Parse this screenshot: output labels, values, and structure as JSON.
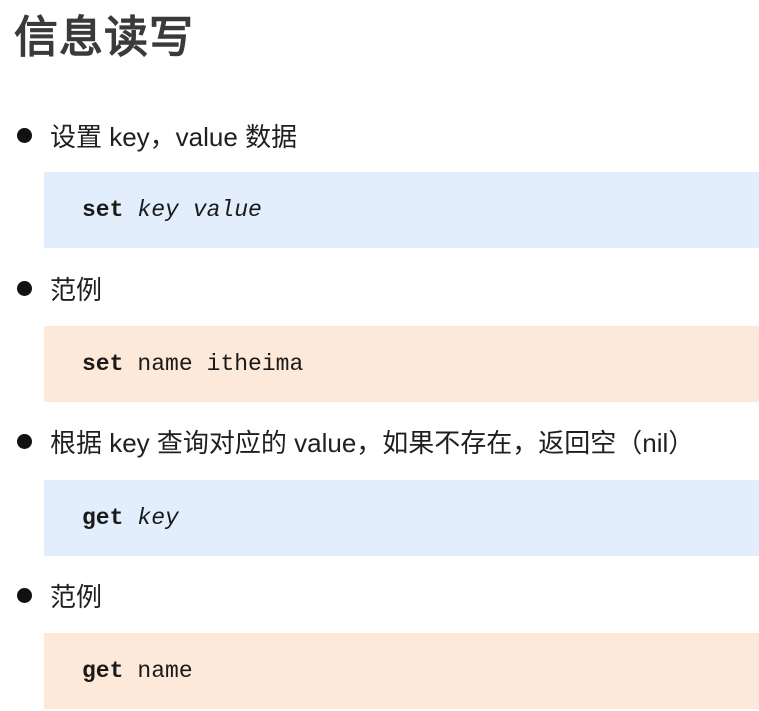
{
  "title": "信息读写",
  "sections": [
    {
      "bullet": "设置 key，value 数据",
      "code": {
        "command": "set",
        "args": [
          "key",
          "value"
        ],
        "args_italic": true
      }
    },
    {
      "bullet": "范例",
      "code": {
        "command": "set",
        "args": [
          "name",
          "itheima"
        ],
        "args_italic": false
      }
    },
    {
      "bullet": "根据 key 查询对应的 value，如果不存在，返回空（nil）",
      "code": {
        "command": "get",
        "args": [
          "key"
        ],
        "args_italic": true
      }
    },
    {
      "bullet": "范例",
      "code": {
        "command": "get",
        "args": [
          "name"
        ],
        "args_italic": false
      }
    }
  ],
  "colors": {
    "syntax_block": "#e3eefd",
    "example_block": "#fde9da"
  }
}
